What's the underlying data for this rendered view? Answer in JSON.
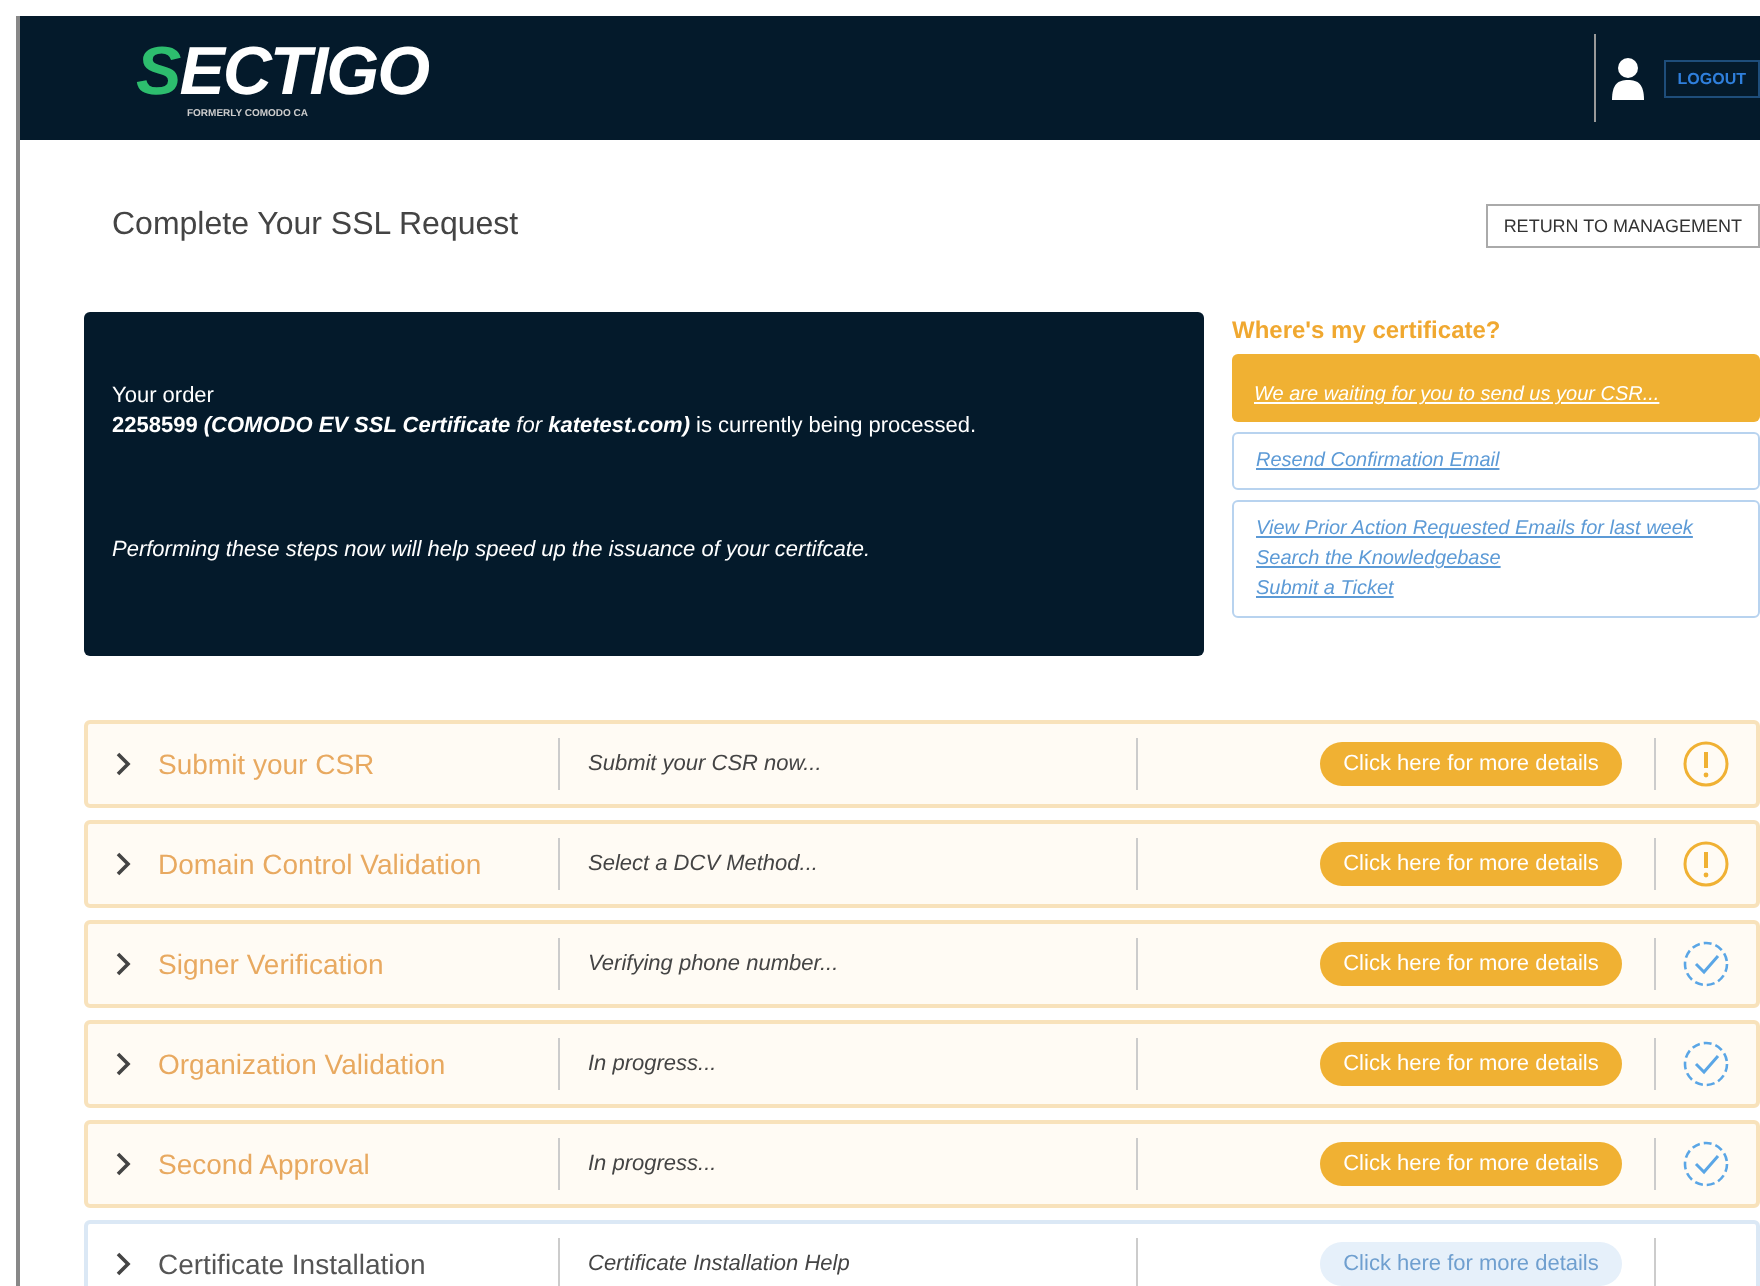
{
  "header": {
    "logo_mark": "S",
    "logo_text": "ECTIGO",
    "logo_tagline": "FORMERLY COMODO CA",
    "logout": "LOGOUT"
  },
  "page_title": "Complete Your SSL Request",
  "return_button": "RETURN TO MANAGEMENT",
  "order_panel": {
    "intro": "Your order",
    "status": "**2258599** **(COMODO EV SSL Certificate** *for* **katetest.com)** is currently being processed.",
    "note": "Performing these steps now will help speed up the issuance of your certifcate."
  },
  "help": {
    "title": "Where's my certificate?",
    "alert": "We are waiting for you to send us your CSR...",
    "resend": "Resend Confirmation Email",
    "links": [
      "View Prior Action Requested Emails for last week",
      "Search the Knowledgebase",
      "Submit a Ticket"
    ]
  },
  "steps": [
    {
      "title": "Submit your CSR",
      "status": "Submit your CSR now...",
      "button": "Click here for more details",
      "kind": "pending"
    },
    {
      "title": "Domain Control Validation",
      "status": "Select a DCV Method...",
      "button": "Click here for more details",
      "kind": "pending"
    },
    {
      "title": "Signer Verification",
      "status": "Verifying phone number...",
      "button": "Click here for more details",
      "kind": "progress"
    },
    {
      "title": "Organization Validation",
      "status": "In progress...",
      "button": "Click here for more details",
      "kind": "progress"
    },
    {
      "title": "Second Approval",
      "status": "In progress...",
      "button": "Click here for more details",
      "kind": "progress"
    },
    {
      "title": "Certificate Installation",
      "status": "Certificate Installation Help",
      "button": "Click here for more details",
      "kind": "inactive"
    }
  ]
}
